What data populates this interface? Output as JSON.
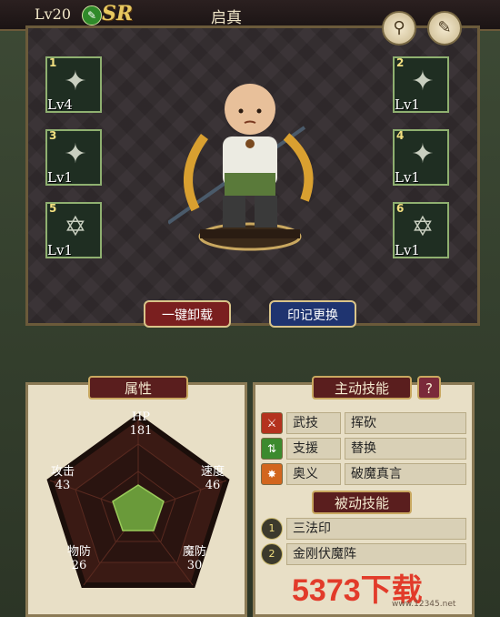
{
  "header": {
    "level": "Lv20",
    "rarity": "SR",
    "name": "启真"
  },
  "toolbar": {
    "search_icon": "magnifier",
    "notes_icon": "notepad"
  },
  "slots": [
    {
      "number": "1",
      "level": "Lv4"
    },
    {
      "number": "2",
      "level": "Lv1"
    },
    {
      "number": "3",
      "level": "Lv1"
    },
    {
      "number": "4",
      "level": "Lv1"
    },
    {
      "number": "5",
      "level": "Lv1"
    },
    {
      "number": "6",
      "level": "Lv1"
    }
  ],
  "buttons": {
    "unequip_all": "一键卸载",
    "change_seal": "印记更换"
  },
  "attributes": {
    "title": "属性",
    "stats": {
      "hp_label": "HP",
      "hp": "181",
      "speed_label": "速度",
      "speed": "46",
      "mdef_label": "魔防",
      "mdef": "30",
      "pdef_label": "物防",
      "pdef": "26",
      "atk_label": "攻击",
      "atk": "43"
    },
    "radar_values": {
      "hp": 0.45,
      "speed": 0.45,
      "mdef": 0.45,
      "pdef": 0.45,
      "atk": 0.45
    }
  },
  "active_skills": {
    "title": "主动技能",
    "help": "?",
    "items": [
      {
        "category": "武技",
        "name": "挥砍",
        "color": "#b4321e"
      },
      {
        "category": "支援",
        "name": "替换",
        "color": "#3c8a2e"
      },
      {
        "category": "奥义",
        "name": "破魔真言",
        "color": "#d2661e"
      }
    ]
  },
  "passive_skills": {
    "title": "被动技能",
    "items": [
      {
        "number": "1",
        "name": "三法印"
      },
      {
        "number": "2",
        "name": "金刚伏魔阵"
      }
    ]
  },
  "watermark": {
    "text": "5373下载",
    "url": "www.12345.net"
  },
  "colors": {
    "accent_gold": "#c9a860",
    "header_red": "#5a1e1e",
    "button_red": "#7a1f1f",
    "button_blue": "#1f3470",
    "radar_green": "#6a9a3a"
  }
}
